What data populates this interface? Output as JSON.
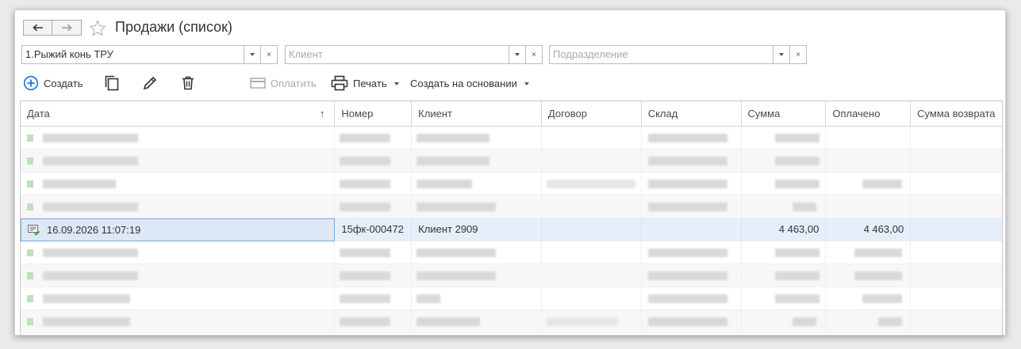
{
  "header": {
    "title": "Продажи (список)"
  },
  "filters": {
    "organization": {
      "value": "1.Рыжий конь ТРУ",
      "placeholder": ""
    },
    "client": {
      "value": "",
      "placeholder": "Клиент"
    },
    "division": {
      "value": "",
      "placeholder": "Подразделение"
    },
    "dropdown_glyph": "▾",
    "clear_glyph": "×"
  },
  "toolbar": {
    "create_label": "Создать",
    "pay_label": "Оплатить",
    "print_label": "Печать",
    "create_based_label": "Создать на основании"
  },
  "table": {
    "columns": [
      "Дата",
      "Номер",
      "Клиент",
      "Договор",
      "Склад",
      "Сумма",
      "Оплачено",
      "Сумма возврата"
    ],
    "sort_indicator": "↑",
    "selected_row": {
      "date": "16.09.2026 11:07:19",
      "number": "15фк-000472",
      "client": "Клиент 2909",
      "contract": "",
      "warehouse": "",
      "sum": "4 463,00",
      "paid": "4 463,00",
      "return_sum": ""
    }
  },
  "colors": {
    "accent": "#1f6fd1",
    "selection_bg": "#e6eefa",
    "selection_border": "#7aa6dc",
    "status_green": "#bfe0bd"
  }
}
